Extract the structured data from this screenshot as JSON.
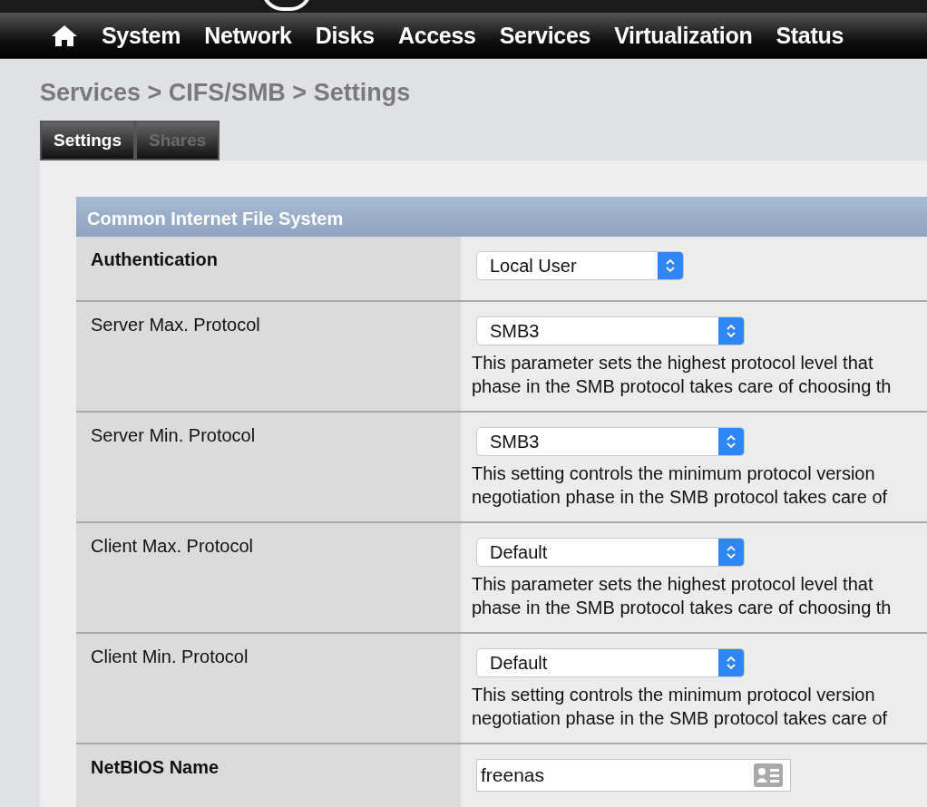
{
  "nav": {
    "items": [
      "System",
      "Network",
      "Disks",
      "Access",
      "Services",
      "Virtualization",
      "Status"
    ]
  },
  "breadcrumb": "Services > CIFS/SMB > Settings",
  "tabs": [
    {
      "label": "Settings",
      "selected": true
    },
    {
      "label": "Shares",
      "selected": false
    }
  ],
  "section": {
    "title": "Common Internet File System",
    "rows": [
      {
        "label": "Authentication",
        "required": true,
        "kind": "select",
        "value": "Local User",
        "description": []
      },
      {
        "label": "Server Max. Protocol",
        "required": false,
        "kind": "select",
        "value": "SMB3",
        "description": [
          "This parameter sets the highest protocol level that",
          "phase in the SMB protocol takes care of choosing th"
        ]
      },
      {
        "label": "Server Min. Protocol",
        "required": false,
        "kind": "select",
        "value": "SMB3",
        "description": [
          "This setting controls the minimum protocol version",
          "negotiation phase in the SMB protocol takes care of"
        ]
      },
      {
        "label": "Client Max. Protocol",
        "required": false,
        "kind": "select",
        "value": "Default",
        "description": [
          "This parameter sets the highest protocol level that",
          "phase in the SMB protocol takes care of choosing th"
        ]
      },
      {
        "label": "Client Min. Protocol",
        "required": false,
        "kind": "select",
        "value": "Default",
        "description": [
          "This setting controls the minimum protocol version",
          "negotiation phase in the SMB protocol takes care of"
        ]
      },
      {
        "label": "NetBIOS Name",
        "required": true,
        "kind": "text",
        "value": "freenas",
        "description": []
      }
    ]
  }
}
